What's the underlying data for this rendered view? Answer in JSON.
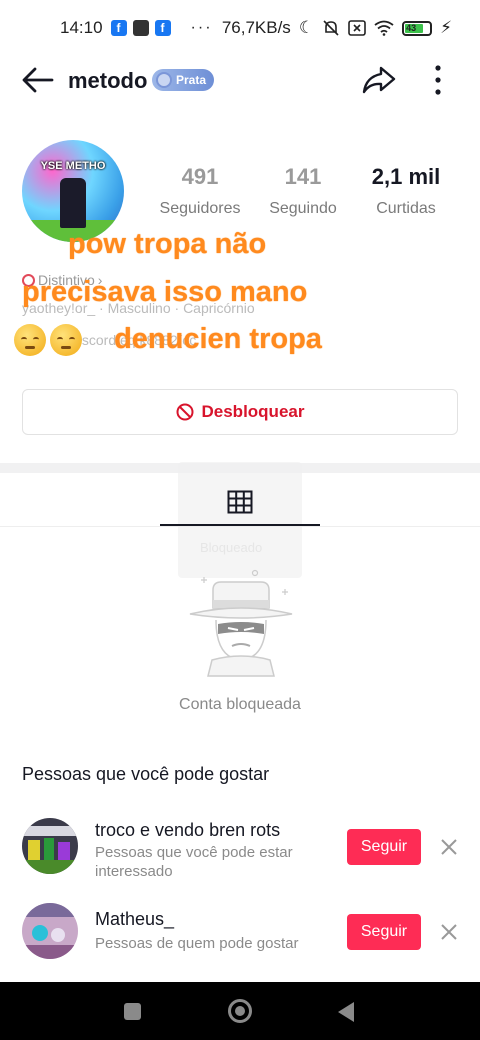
{
  "status_bar": {
    "time": "14:10",
    "network_speed": "76,7KB/s",
    "battery": "43",
    "icons": [
      "facebook-icon",
      "app-icon",
      "facebook-icon",
      "more-dots-icon",
      "moon-icon",
      "mute-icon",
      "close-box-icon",
      "wifi-icon",
      "battery-icon",
      "charging-icon"
    ]
  },
  "header": {
    "username": "metodo",
    "badge": "Prata",
    "icons": [
      "back-arrow-icon",
      "share-icon",
      "more-vertical-icon"
    ]
  },
  "profile": {
    "avatar_text": "YSE METHO",
    "stats": [
      {
        "value": "491",
        "label": "Seguidores"
      },
      {
        "value": "141",
        "label": "Seguindo"
      },
      {
        "value": "2,1 mil",
        "label": "Curtidas"
      }
    ],
    "distintivo": "Distintivo",
    "bio_line1": "yaothey!or_ · Masculino · Capricórnio",
    "bio_line2": "disscord:eq.k8882(cc"
  },
  "overlay": {
    "line1": "pow tropa não",
    "line2": "precisava isso mano",
    "line3": "denucien tropa"
  },
  "actions": {
    "unblock_label": "Desbloquear"
  },
  "tabs": {
    "ghost_label": "Bloqueado"
  },
  "blocked": {
    "label": "Conta bloqueada"
  },
  "suggestions": {
    "title": "Pessoas que você pode gostar",
    "items": [
      {
        "name": "troco e vendo bren rots",
        "subtitle": "Pessoas que você pode estar interessado",
        "button": "Seguir"
      },
      {
        "name": "Matheus_",
        "subtitle": "Pessoas de quem pode gostar",
        "button": "Seguir"
      }
    ]
  },
  "colors": {
    "accent": "#fe2c55",
    "unblock_text": "#d8142c",
    "overlay": "#ff8a1e"
  }
}
